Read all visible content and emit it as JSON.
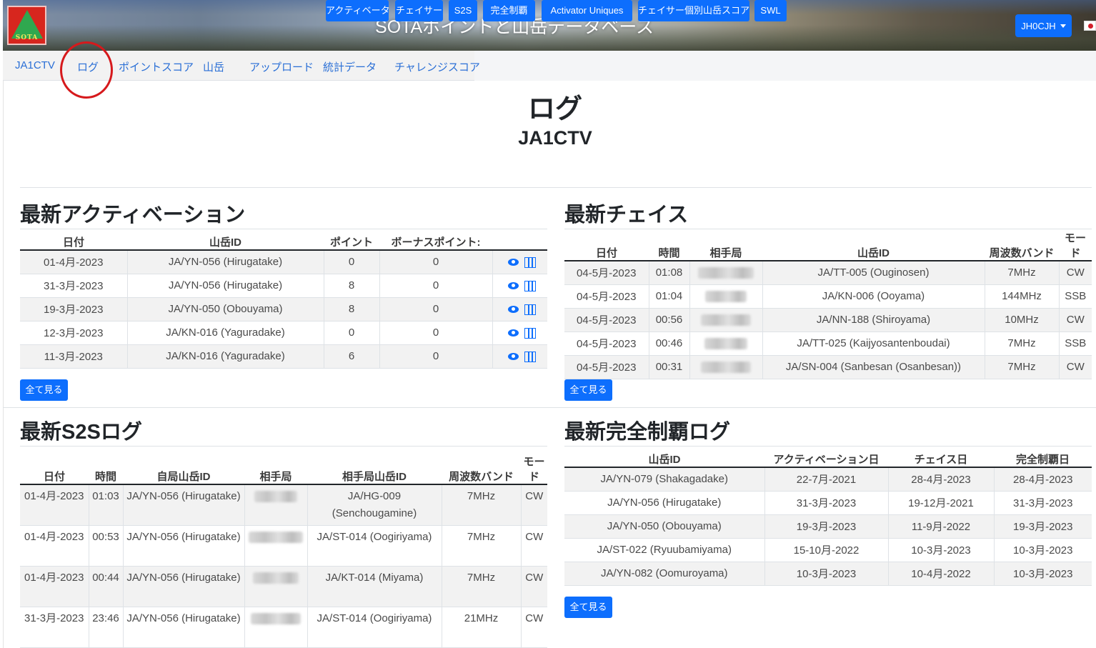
{
  "header": {
    "logo_text": "SOTA",
    "title": "SOTAポイントと山岳データベース",
    "user": "JH0CJH"
  },
  "nav": [
    "JA1CTV",
    "ログ",
    "ポイントスコア",
    "山岳",
    "アップロード",
    "統計データ",
    "チャレンジスコア"
  ],
  "page": {
    "title": "ログ",
    "callsign": "JA1CTV",
    "buttons": [
      "アクティベータ",
      "チェイサー",
      "S2S",
      "完全制覇",
      "Activator Uniques",
      "チェイサー個別山岳スコア",
      "SWL"
    ]
  },
  "activations": {
    "title": "最新アクティベーション",
    "columns": [
      "日付",
      "山岳ID",
      "ポイント",
      "ボーナスポイント:",
      ""
    ],
    "rows": [
      [
        "01-4月-2023",
        "JA/YN-056 (Hirugatake)",
        "0",
        "0"
      ],
      [
        "31-3月-2023",
        "JA/YN-056 (Hirugatake)",
        "8",
        "0"
      ],
      [
        "19-3月-2023",
        "JA/YN-050 (Obouyama)",
        "8",
        "0"
      ],
      [
        "12-3月-2023",
        "JA/KN-016 (Yaguradake)",
        "0",
        "0"
      ],
      [
        "11-3月-2023",
        "JA/KN-016 (Yaguradake)",
        "6",
        "0"
      ]
    ],
    "view_all": "全て見る"
  },
  "chases": {
    "title": "最新チェイス",
    "columns": [
      "日付",
      "時間",
      "相手局",
      "山岳ID",
      "周波数バンド",
      "モード"
    ],
    "rows": [
      [
        "04-5月-2023",
        "01:08",
        "",
        "JA/TT-005 (Ouginosen)",
        "7MHz",
        "CW"
      ],
      [
        "04-5月-2023",
        "01:04",
        "",
        "JA/KN-006 (Ooyama)",
        "144MHz",
        "SSB"
      ],
      [
        "04-5月-2023",
        "00:56",
        "",
        "JA/NN-188 (Shiroyama)",
        "10MHz",
        "CW"
      ],
      [
        "04-5月-2023",
        "00:46",
        "",
        "JA/TT-025 (Kaijyosantenboudai)",
        "7MHz",
        "SSB"
      ],
      [
        "04-5月-2023",
        "00:31",
        "",
        "JA/SN-004 (Sanbesan (Osanbesan))",
        "7MHz",
        "CW"
      ]
    ],
    "view_all": "全て見る"
  },
  "s2s": {
    "title": "最新S2Sログ",
    "columns": [
      "日付",
      "時間",
      "自局山岳ID",
      "相手局",
      "相手局山岳ID",
      "周波数バンド",
      "モード"
    ],
    "rows": [
      [
        "01-4月-2023",
        "01:03",
        "JA/YN-056 (Hirugatake)",
        "",
        "JA/HG-009 (Senchougamine)",
        "7MHz",
        "CW"
      ],
      [
        "01-4月-2023",
        "00:53",
        "JA/YN-056 (Hirugatake)",
        "",
        "JA/ST-014 (Oogiriyama)",
        "7MHz",
        "CW"
      ],
      [
        "01-4月-2023",
        "00:44",
        "JA/YN-056 (Hirugatake)",
        "",
        "JA/KT-014 (Miyama)",
        "7MHz",
        "CW"
      ],
      [
        "31-3月-2023",
        "23:46",
        "JA/YN-056 (Hirugatake)",
        "",
        "JA/ST-014 (Oogiriyama)",
        "21MHz",
        "CW"
      ]
    ]
  },
  "complete": {
    "title": "最新完全制覇ログ",
    "columns": [
      "山岳ID",
      "アクティベーション日",
      "チェイス日",
      "完全制覇日"
    ],
    "rows": [
      [
        "JA/YN-079 (Shakagadake)",
        "22-7月-2021",
        "28-4月-2023",
        "28-4月-2023"
      ],
      [
        "JA/YN-056 (Hirugatake)",
        "31-3月-2023",
        "19-12月-2021",
        "31-3月-2023"
      ],
      [
        "JA/YN-050 (Obouyama)",
        "19-3月-2023",
        "11-9月-2022",
        "19-3月-2023"
      ],
      [
        "JA/ST-022 (Ryuubamiyama)",
        "15-10月-2022",
        "10-3月-2023",
        "10-3月-2023"
      ],
      [
        "JA/YN-082 (Oomuroyama)",
        "10-3月-2023",
        "10-4月-2022",
        "10-3月-2023"
      ]
    ],
    "view_all": "全て見る"
  },
  "colors": {
    "primary": "#0d6efd",
    "link": "#2a6fd6",
    "annotation": "#d6191c"
  }
}
